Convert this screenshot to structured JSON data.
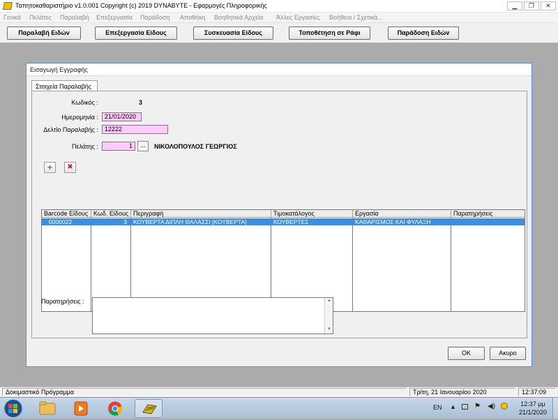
{
  "window": {
    "title": "Ταπητοκαθαριστήριο v1.0.001   Copyright (c) 2019  DYNABYTE - Εφαρμογές Πληροφορικής",
    "controls": {
      "minimize": "▁",
      "restore": "❐",
      "close": "✕"
    }
  },
  "menu": [
    "Γενικά",
    "Πελάτες",
    "Παραλαβή",
    "Επεξεργασία",
    "Παράδοση",
    "Αποθήκη",
    "Βοηθητικά Αρχεία",
    "Άλλες Εργασίες",
    "Βοήθεια / Σχετικά..."
  ],
  "toolbar": [
    "Παραλαβή Ειδών",
    "Επεξεργασία Είδους",
    "Συσκευασία Είδους",
    "Τοποθέτηση σε Ράφι",
    "Παράδοση Ειδών"
  ],
  "dialog": {
    "title": "Εισαγωγή Εγγραφής",
    "tab": "Στοιχεία Παραλαβής",
    "fields": {
      "code_label": "Κωδικός :",
      "code_value": "3",
      "date_label": "Ημερομηνία :",
      "date_value": "21/01/2020",
      "slip_label": "Δελτίο Παραλαβής :",
      "slip_value": "12222",
      "customer_label": "Πελάτης :",
      "customer_id": "1",
      "customer_browse": "...",
      "customer_name": "ΝΙΚΟΛΟΠΟΥΛΟΣ ΓΕΩΡΓΙΟΣ"
    },
    "add_symbol": "+",
    "delete_symbol": "✖",
    "grid": {
      "columns": [
        "Barcode Είδους",
        "Κωδ. Είδους",
        "Περιγραφή",
        "Τιμοκατάλογος",
        "Εργασία",
        "Παρατηρήσεις"
      ],
      "rows": [
        [
          "0000022",
          "3",
          "ΚΟΥΒΕΡΤΑ ΔΙΠΛΗ ΘΑΛΑΣΣΙ  [ΚΟΥΒΕΡΤΑ]",
          "ΚΟΥΒΕΡΤΕΣ",
          "ΚΑΘΑΡΙΣΜΟΣ ΚΑΙ ΦΥΛΑΞΗ",
          ""
        ]
      ]
    },
    "notes_label": "Παρατηρήσεις :",
    "notes_value": "",
    "ok": "OK",
    "cancel": "Ακυρο"
  },
  "status": {
    "left": "Δοκιμαστικό Πρόγραμμα",
    "date": "Τρίτη, 21 Ιανουαρίου 2020",
    "time": "12:37:09"
  },
  "taskbar": {
    "lang": "EN",
    "clock_time": "12:37 μμ",
    "clock_date": "21/1/2020"
  }
}
